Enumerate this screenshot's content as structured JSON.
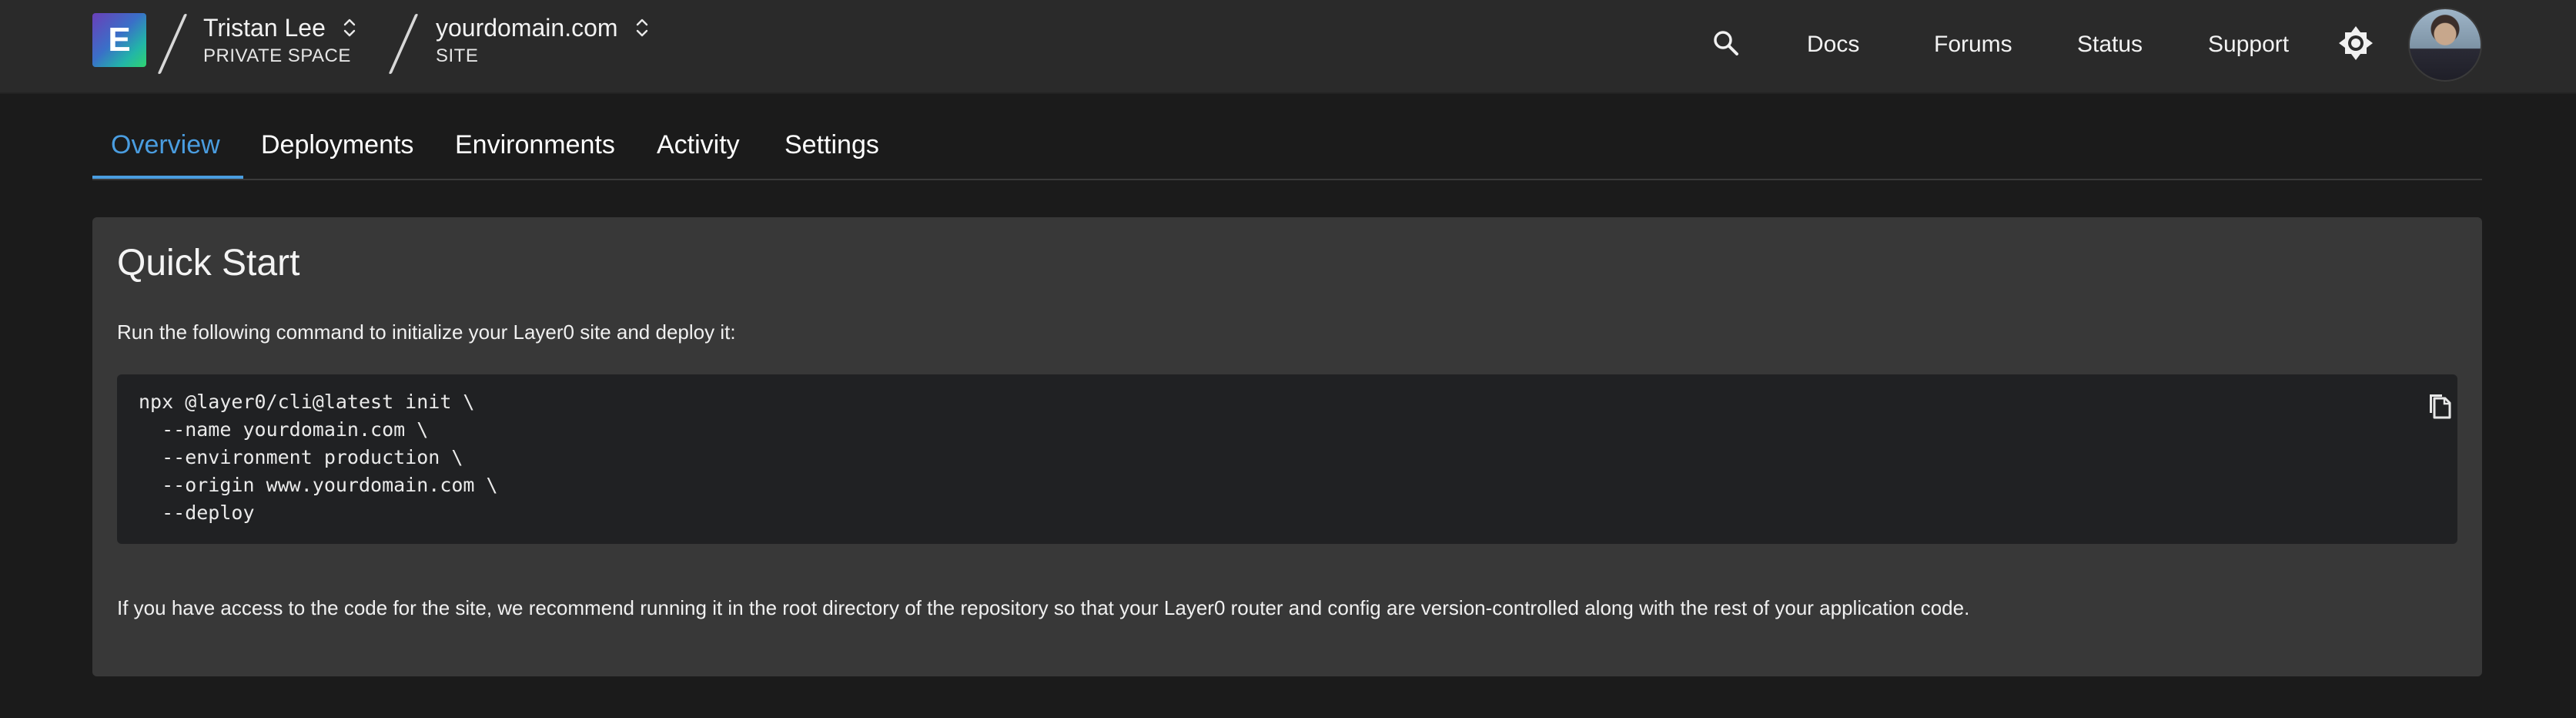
{
  "header": {
    "logo_letter": "E",
    "team": {
      "name": "Tristan Lee",
      "type": "PRIVATE SPACE"
    },
    "site": {
      "name": "yourdomain.com",
      "type": "SITE"
    },
    "nav": {
      "docs": "Docs",
      "forums": "Forums",
      "status": "Status",
      "support": "Support"
    },
    "icons": {
      "search": "search-icon",
      "theme": "brightness-icon",
      "switch": "unfold-icon",
      "avatar": "user-avatar"
    }
  },
  "tabs": [
    {
      "label": "Overview",
      "active": true
    },
    {
      "label": "Deployments",
      "active": false
    },
    {
      "label": "Environments",
      "active": false
    },
    {
      "label": "Activity",
      "active": false
    },
    {
      "label": "Settings",
      "active": false
    }
  ],
  "quick_start": {
    "title": "Quick Start",
    "intro": "Run the following command to initialize your Layer0 site and deploy it:",
    "code_lines": [
      "npx @layer0/cli@latest init \\",
      "  --name yourdomain.com \\",
      "  --environment production \\",
      "  --origin www.yourdomain.com \\",
      "  --deploy"
    ],
    "note": "If you have access to the code for the site, we recommend running it in the root directory of the repository so that your Layer0 router and config are version-controlled along with the rest of your application code.",
    "copy_icon": "copy-icon"
  },
  "colors": {
    "accent": "#4a9de0",
    "background": "#1b1b1b",
    "topbar": "#2a2a2a",
    "card": "#383838",
    "code_bg": "#202123"
  }
}
